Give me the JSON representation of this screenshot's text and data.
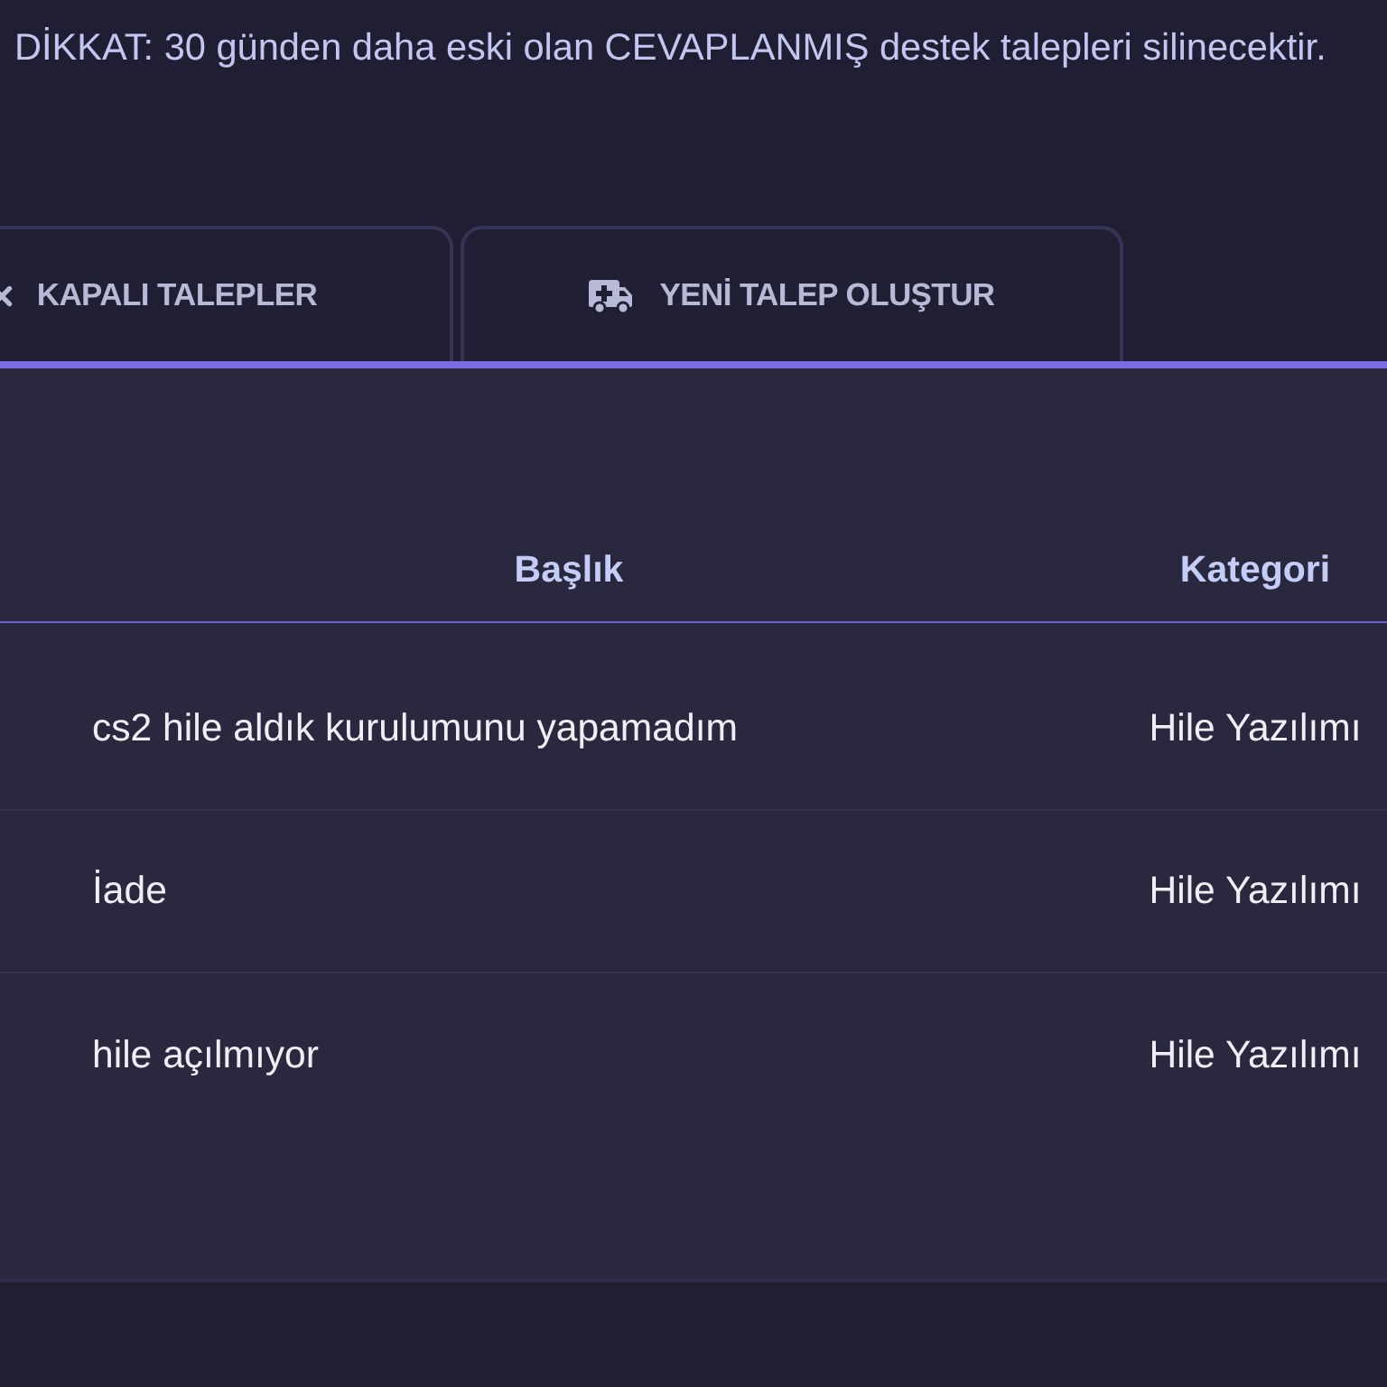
{
  "notice": "DİKKAT: 30 günden daha eski olan CEVAPLANMIŞ destek talepleri silinecektir.",
  "tabs": [
    {
      "label": "KAPALI TALEPLER",
      "kind": "closed",
      "selected": false
    },
    {
      "label": "YENİ TALEP OLUŞTUR",
      "kind": "create",
      "selected": false
    }
  ],
  "table": {
    "columns": [
      "Başlık",
      "Kategori"
    ],
    "rows": [
      {
        "cells": [
          "cs2 hile aldık kurulumunu yapamadım",
          "Hile Yazılımı"
        ]
      },
      {
        "cells": [
          "İade",
          "Hile Yazılımı"
        ]
      },
      {
        "cells": [
          "hile açılmıyor",
          "Hile Yazılımı"
        ]
      }
    ]
  }
}
